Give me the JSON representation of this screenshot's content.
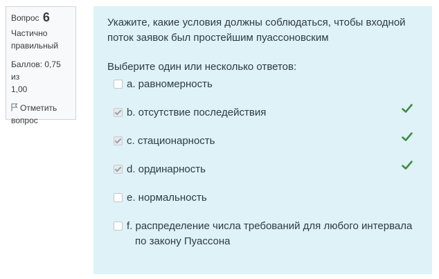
{
  "info": {
    "question_label": "Вопрос",
    "question_number": "6",
    "state_line1": "Частично",
    "state_line2": "правильный",
    "grade_line1": "Баллов: 0,75 из",
    "grade_line2": "1,00",
    "flag_line1": "Отметить",
    "flag_line2": "вопрос"
  },
  "question": {
    "text_line1": "Укажите, какие условия должны соблюдаться, чтобы входной",
    "text_line2": "поток заявок был простейшим пуассоновским",
    "prompt": "Выберите один или несколько ответов:",
    "answers": [
      {
        "label": "a. равномерность",
        "checked": false,
        "correct": false
      },
      {
        "label": "b. отсутствие последействия",
        "checked": true,
        "correct": true
      },
      {
        "label": "c. стационарность",
        "checked": true,
        "correct": true
      },
      {
        "label": "d. ординарность",
        "checked": true,
        "correct": true
      },
      {
        "label": "e. нормальность",
        "checked": false,
        "correct": false
      },
      {
        "label": "f. распределение числа требований для любого интервала",
        "label2": "по закону Пуассона",
        "checked": false,
        "correct": false
      }
    ]
  },
  "colors": {
    "content_bg": "#def2f8",
    "info_bg": "#f8f9fa",
    "tick": "#3d8c40"
  }
}
